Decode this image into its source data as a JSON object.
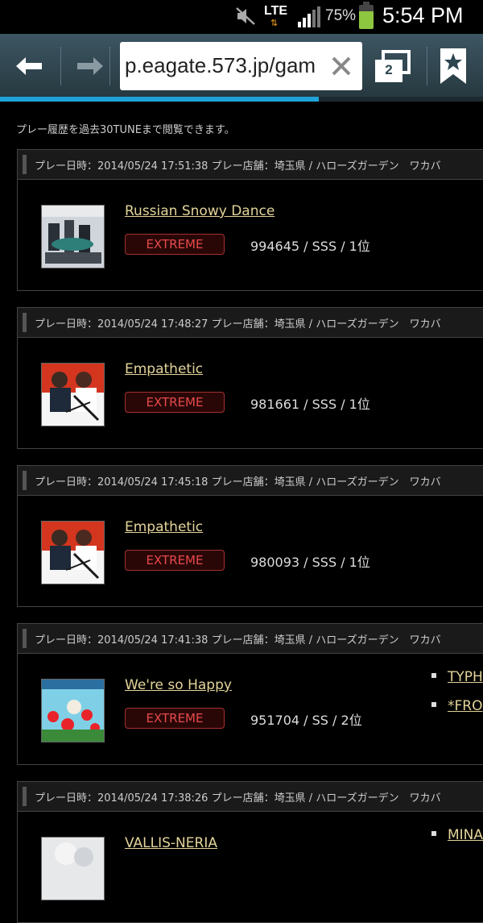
{
  "status_bar": {
    "network": "LTE",
    "battery_percent": "75%",
    "battery_level": 0.75,
    "time": "5:54 PM"
  },
  "browser": {
    "url": "p.eagate.573.jp/gam",
    "tab_count": "2",
    "load_progress": 0.66,
    "colors": {
      "toolbar": "#2f4650",
      "progress": "#1fa3d9"
    }
  },
  "page": {
    "intro": "プレー履歴を過去30TUNEまで閲覧できます。",
    "colors": {
      "link": "#e3d49a",
      "difficulty": "#e74a4a"
    },
    "entries": [
      {
        "header": "プレー日時：2014/05/24 17:51:38 プレー店舗：埼玉県 / ハローズガーデン　ワカバ",
        "jacket": "jacket-russian-snowy-dance",
        "title": "Russian Snowy Dance",
        "difficulty": "EXTREME",
        "result": "994645 / SSS / 1位",
        "side_links": []
      },
      {
        "header": "プレー日時：2014/05/24 17:48:27 プレー店舗：埼玉県 / ハローズガーデン　ワカバ",
        "jacket": "jacket-empathetic",
        "title": "Empathetic",
        "difficulty": "EXTREME",
        "result": "981661 / SSS / 1位",
        "side_links": []
      },
      {
        "header": "プレー日時：2014/05/24 17:45:18 プレー店舗：埼玉県 / ハローズガーデン　ワカバ",
        "jacket": "jacket-empathetic",
        "title": "Empathetic",
        "difficulty": "EXTREME",
        "result": "980093 / SSS / 1位",
        "side_links": []
      },
      {
        "header": "プレー日時：2014/05/24 17:41:38 プレー店舗：埼玉県 / ハローズガーデン　ワカバ",
        "jacket": "jacket-were-so-happy",
        "title": "We're so Happy",
        "difficulty": "EXTREME",
        "result": "951704 / SS / 2位",
        "side_links": [
          "TYPH",
          "*FRO"
        ]
      },
      {
        "header": "プレー日時：2014/05/24 17:38:26 プレー店舗：埼玉県 / ハローズガーデン　ワカバ",
        "jacket": "jacket-vallis-neria",
        "title": "VALLIS-NERIA",
        "difficulty": "",
        "result": "",
        "side_links": [
          "MINA"
        ]
      }
    ]
  }
}
